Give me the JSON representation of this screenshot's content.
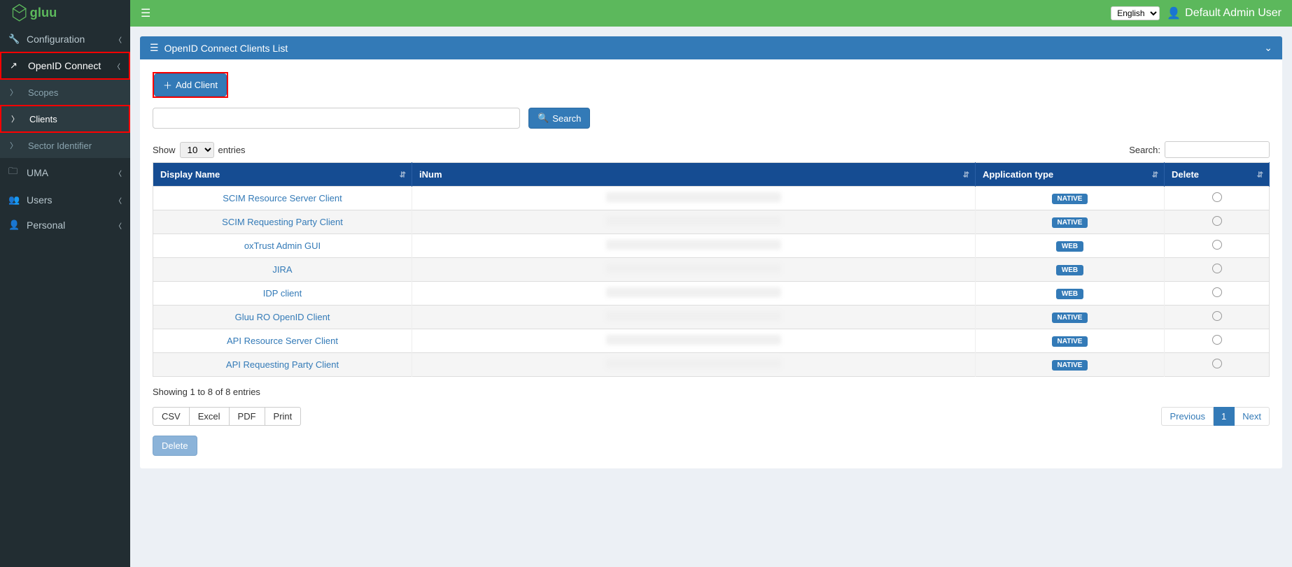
{
  "brand": "gluu",
  "topbar": {
    "language": "English",
    "user_name": "Default Admin User"
  },
  "sidebar": {
    "items": [
      {
        "icon": "wrench",
        "label": "Configuration",
        "has_children": true
      },
      {
        "icon": "external",
        "label": "OpenID Connect",
        "has_children": true,
        "highlighted": true,
        "children": [
          {
            "label": "Scopes"
          },
          {
            "label": "Clients",
            "active": true,
            "highlighted": true
          },
          {
            "label": "Sector Identifier"
          }
        ]
      },
      {
        "icon": "folder",
        "label": "UMA",
        "has_children": true
      },
      {
        "icon": "users",
        "label": "Users",
        "has_children": true
      },
      {
        "icon": "user",
        "label": "Personal",
        "has_children": true
      }
    ]
  },
  "panel": {
    "title": "OpenID Connect Clients List",
    "add_button": "Add Client",
    "search_button": "Search",
    "show_label_pre": "Show",
    "show_label_post": "entries",
    "show_value": "10",
    "table_search_label": "Search:",
    "columns": [
      "Display Name",
      "iNum",
      "Application type",
      "Delete"
    ],
    "rows": [
      {
        "name": "SCIM Resource Server Client",
        "type": "NATIVE"
      },
      {
        "name": "SCIM Requesting Party Client",
        "type": "NATIVE"
      },
      {
        "name": "oxTrust Admin GUI",
        "type": "WEB"
      },
      {
        "name": "JIRA",
        "type": "WEB"
      },
      {
        "name": "IDP client",
        "type": "WEB"
      },
      {
        "name": "Gluu RO OpenID Client",
        "type": "NATIVE"
      },
      {
        "name": "API Resource Server Client",
        "type": "NATIVE"
      },
      {
        "name": "API Requesting Party Client",
        "type": "NATIVE"
      }
    ],
    "info_text": "Showing 1 to 8 of 8 entries",
    "export_buttons": [
      "CSV",
      "Excel",
      "PDF",
      "Print"
    ],
    "pagination": {
      "previous": "Previous",
      "next": "Next",
      "pages": [
        "1"
      ],
      "active": "1"
    },
    "delete_button": "Delete"
  }
}
